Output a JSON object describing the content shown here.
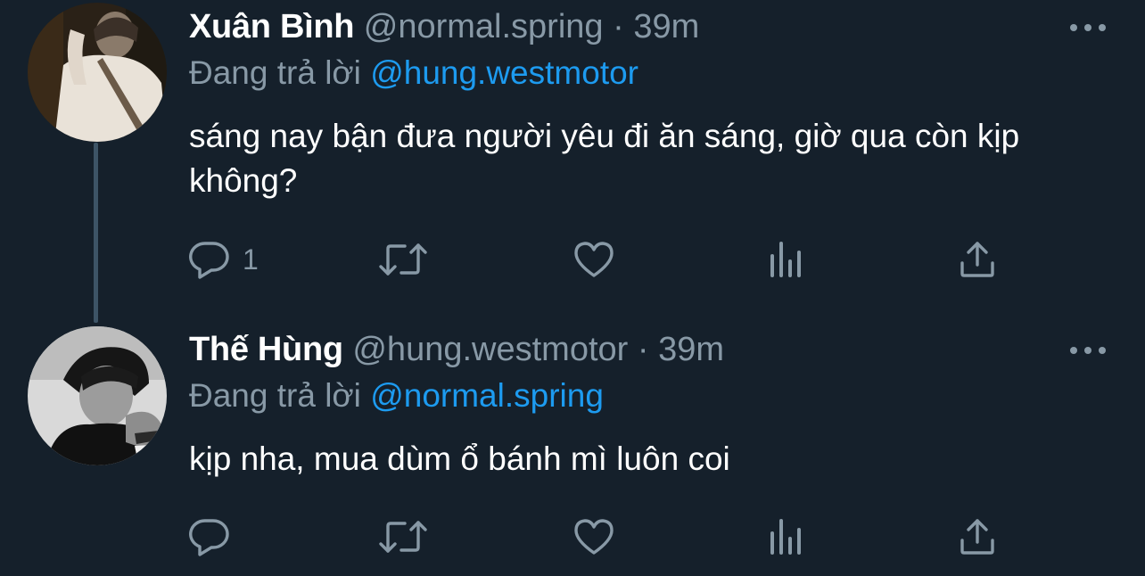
{
  "colors": {
    "background": "#15202b",
    "primary_text": "#ffffff",
    "secondary_text": "#8899a6",
    "mention": "#1d9bf0",
    "thread_line": "#3d5466"
  },
  "tweets": [
    {
      "display_name": "Xuân Bình",
      "handle": "@normal.spring",
      "separator": "·",
      "time": "39m",
      "replying_prefix": "Đang trả lời",
      "replying_to": "@hung.westmotor",
      "text": "sáng nay bận đưa người yêu đi ăn sáng, giờ qua còn kịp không?",
      "reply_count": "1",
      "icons": [
        "reply-icon",
        "retweet-icon",
        "like-icon",
        "analytics-icon",
        "share-icon",
        "more-icon"
      ]
    },
    {
      "display_name": "Thế Hùng",
      "handle": "@hung.westmotor",
      "separator": "·",
      "time": "39m",
      "replying_prefix": "Đang trả lời",
      "replying_to": "@normal.spring",
      "text": "kịp nha, mua dùm ổ bánh mì luôn coi",
      "reply_count": "",
      "icons": [
        "reply-icon",
        "retweet-icon",
        "like-icon",
        "analytics-icon",
        "share-icon",
        "more-icon"
      ]
    }
  ]
}
